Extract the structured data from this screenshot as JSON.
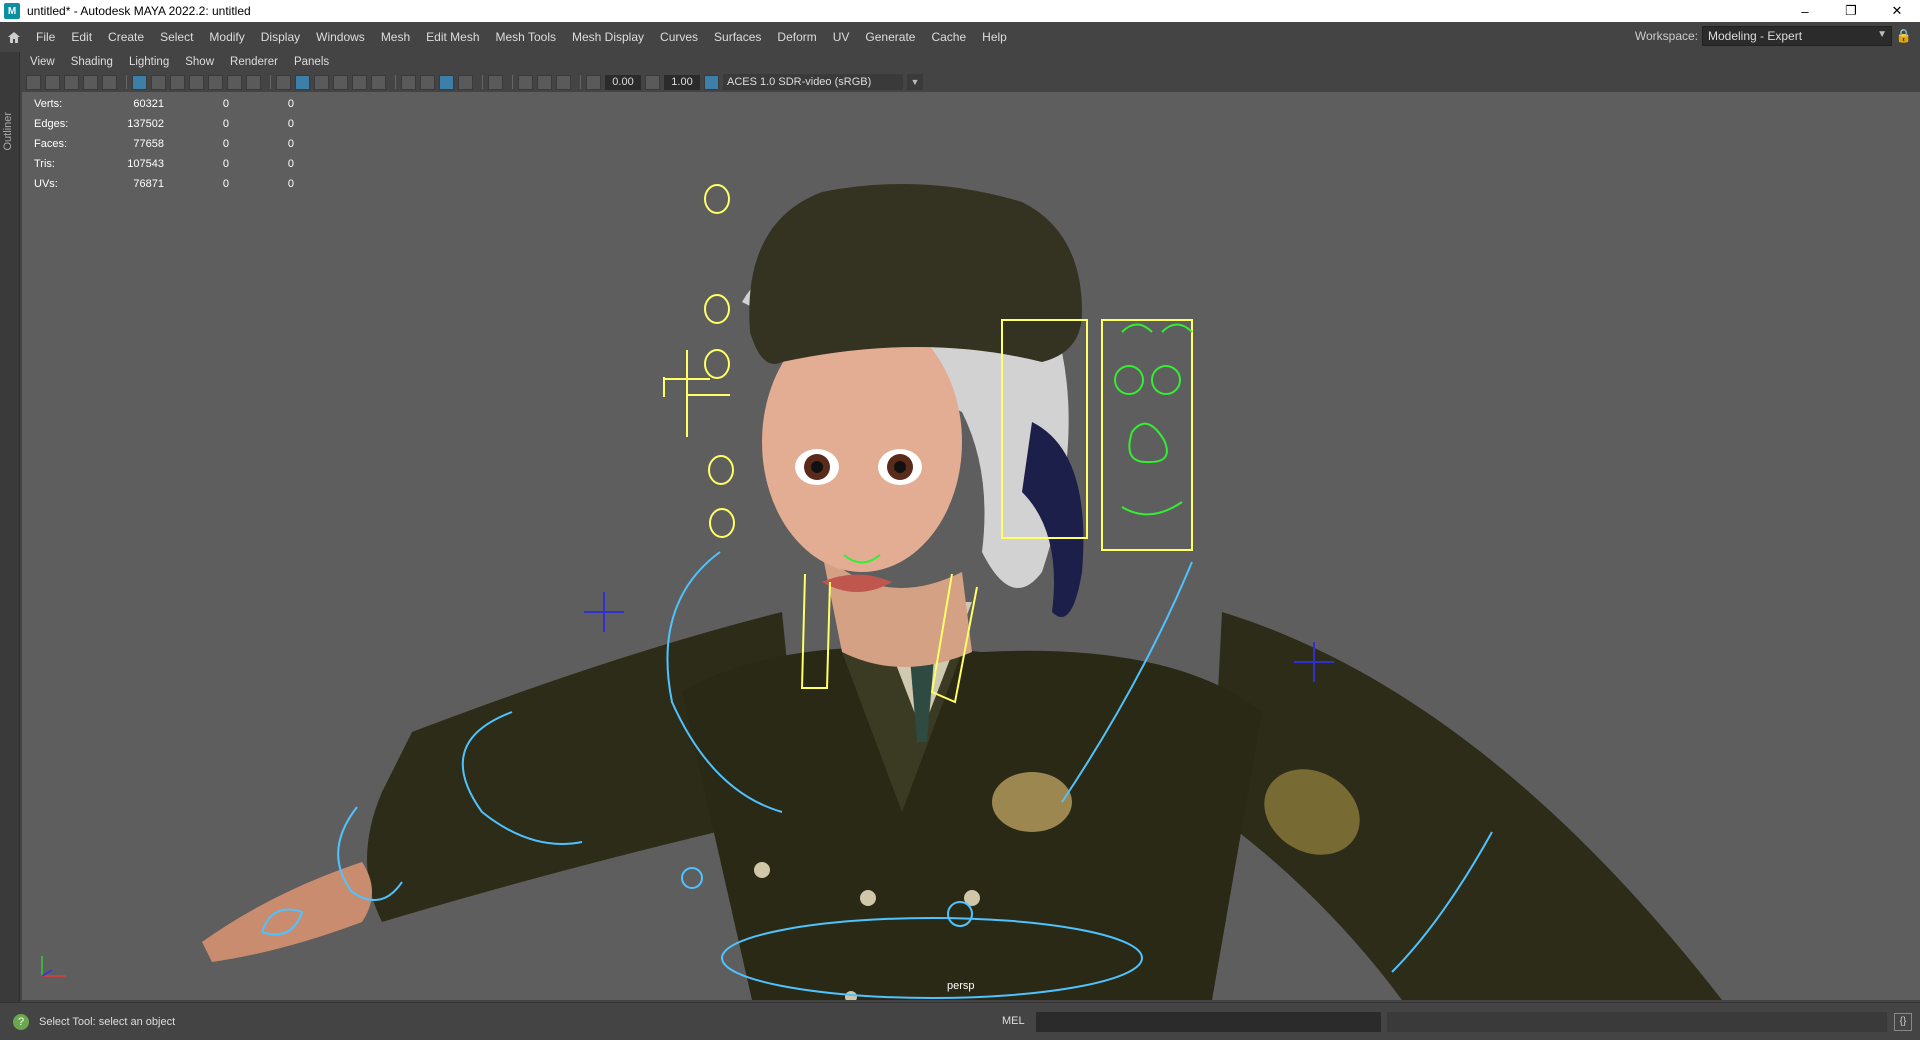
{
  "window": {
    "title": "untitled* - Autodesk MAYA 2022.2: untitled",
    "app_icon": "maya-icon",
    "controls": [
      "minimize-icon",
      "restore-icon",
      "close-icon"
    ]
  },
  "menubar": {
    "items": [
      "File",
      "Edit",
      "Create",
      "Select",
      "Modify",
      "Display",
      "Windows",
      "Mesh",
      "Edit Mesh",
      "Mesh Tools",
      "Mesh Display",
      "Curves",
      "Surfaces",
      "Deform",
      "UV",
      "Generate",
      "Cache",
      "Help"
    ],
    "workspace_label": "Workspace:",
    "workspace_value": "Modeling - Expert"
  },
  "sidebar": {
    "outliner_label": "Outliner"
  },
  "panel_menu": {
    "items": [
      "View",
      "Shading",
      "Lighting",
      "Show",
      "Renderer",
      "Panels"
    ]
  },
  "panel_toolbar": {
    "exposure": "0.00",
    "gamma": "1.00",
    "color_space": "ACES 1.0 SDR-video (sRGB)"
  },
  "hud": {
    "rows": [
      {
        "label": "Verts:",
        "value": "60321",
        "sel": "0",
        "comp": "0"
      },
      {
        "label": "Edges:",
        "value": "137502",
        "sel": "0",
        "comp": "0"
      },
      {
        "label": "Faces:",
        "value": "77658",
        "sel": "0",
        "comp": "0"
      },
      {
        "label": "Tris:",
        "value": "107543",
        "sel": "0",
        "comp": "0"
      },
      {
        "label": "UVs:",
        "value": "76871",
        "sel": "0",
        "comp": "0"
      }
    ]
  },
  "viewport": {
    "camera": "persp",
    "colors": {
      "background": "#5e5e5e",
      "uniform": "#2d2c18",
      "control_yellow": "#ffff66",
      "control_blue": "#4fc3ff",
      "control_green": "#33ee33"
    }
  },
  "statusbar": {
    "message": "Select Tool: select an object",
    "mel_label": "MEL"
  }
}
